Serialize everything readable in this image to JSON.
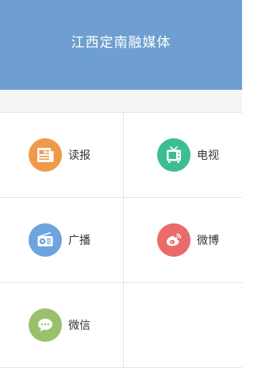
{
  "header": {
    "title": "江西定南融媒体",
    "bg": "#6e9fd0"
  },
  "menu": {
    "items": [
      {
        "label": "读报",
        "icon": "newspaper-icon",
        "color": "#ef9a4b"
      },
      {
        "label": "电视",
        "icon": "tv-icon",
        "color": "#3dbd92"
      },
      {
        "label": "广播",
        "icon": "radio-icon",
        "color": "#6ea4dd"
      },
      {
        "label": "微博",
        "icon": "weibo-icon",
        "color": "#e96c6a"
      },
      {
        "label": "微信",
        "icon": "wechat-icon",
        "color": "#9bc06c"
      }
    ]
  }
}
